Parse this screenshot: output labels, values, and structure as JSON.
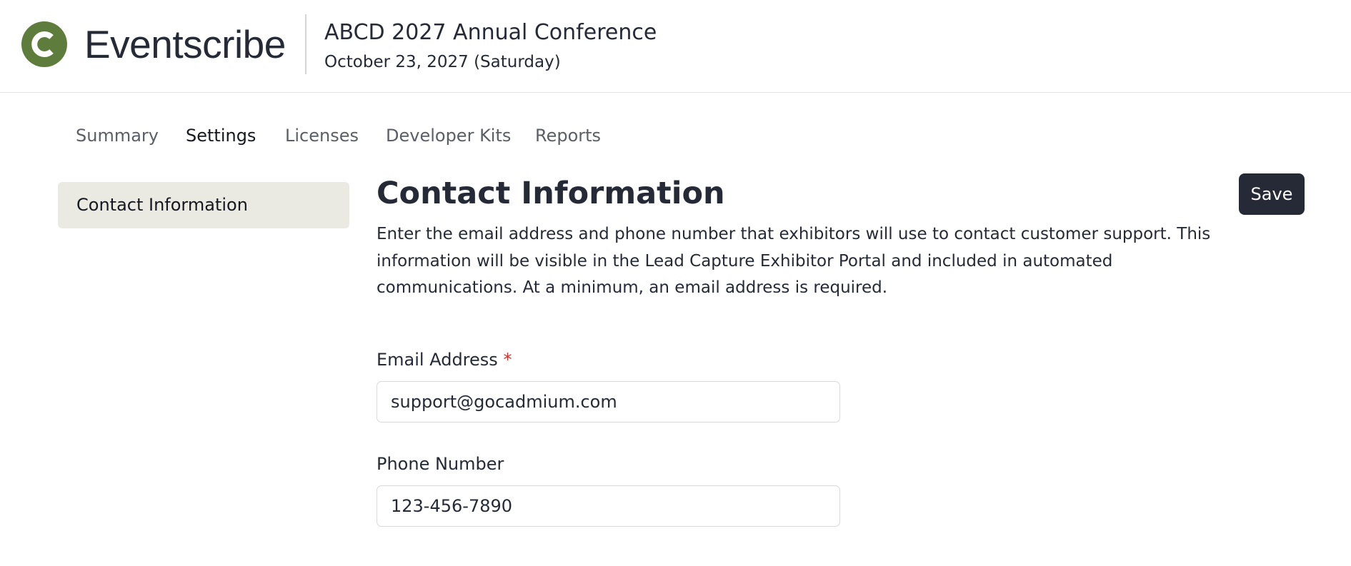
{
  "brand": {
    "name": "Eventscribe",
    "logo_icon": "eventscribe-logo-icon",
    "logo_color": "#5e7d3c"
  },
  "event": {
    "title": "ABCD 2027 Annual Conference",
    "date": "October 23, 2027 (Saturday)"
  },
  "tabs": [
    {
      "label": "Summary",
      "active": false
    },
    {
      "label": "Settings",
      "active": true
    },
    {
      "label": "Licenses",
      "active": false
    },
    {
      "label": "Developer Kits",
      "active": false
    },
    {
      "label": "Reports",
      "active": false
    }
  ],
  "sidebar": {
    "items": [
      {
        "label": "Contact Information",
        "selected": true
      }
    ]
  },
  "main": {
    "title": "Contact Information",
    "save_label": "Save",
    "description": "Enter the email address and phone number that exhibitors will use to contact customer support. This information will be visible in the Lead Capture Exhibitor Portal and included in automated communications. At a minimum, an email address is required.",
    "email": {
      "label": "Email Address",
      "required_mark": "*",
      "value": "support@gocadmium.com"
    },
    "phone": {
      "label": "Phone Number",
      "value": "123-456-7890"
    }
  },
  "colors": {
    "primary_dark": "#252a36",
    "sidebar_selected_bg": "#eaeae2",
    "required": "#d0342c"
  }
}
